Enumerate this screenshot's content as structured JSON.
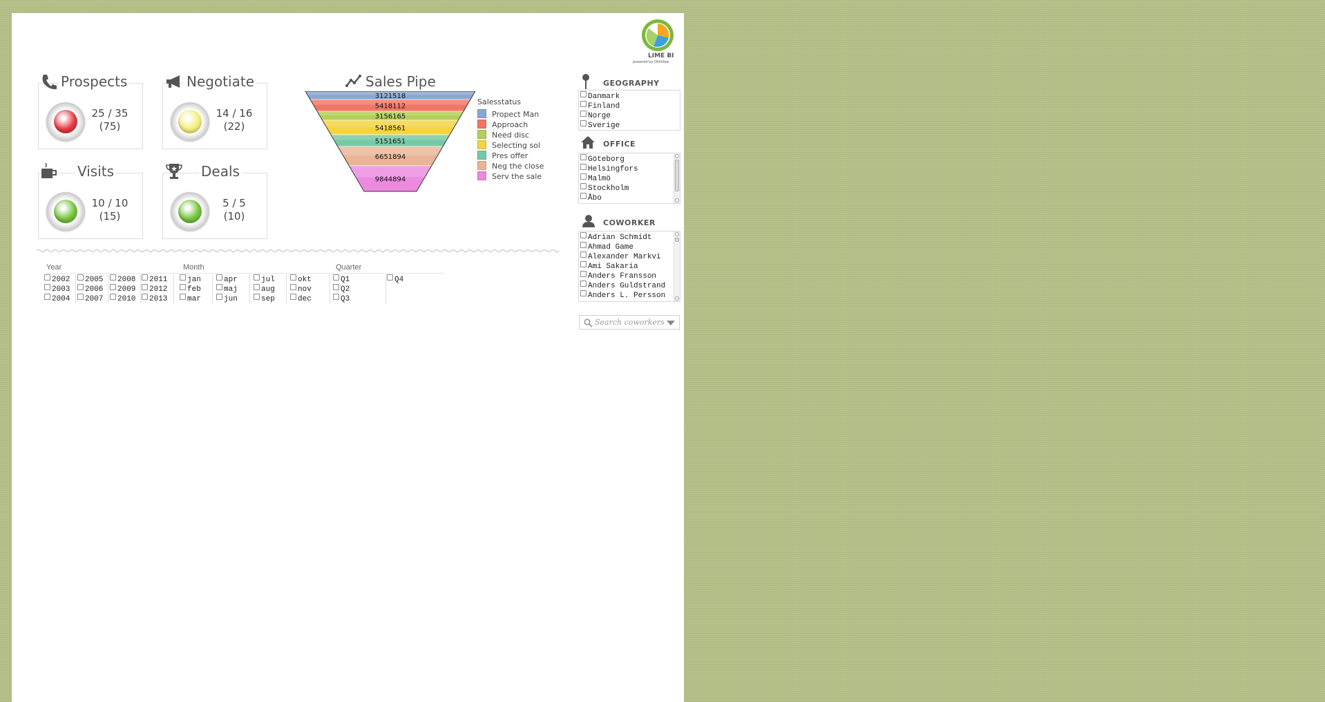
{
  "kpis": {
    "prospects": {
      "title": "Prospects",
      "value": "25 / 35",
      "sub": "(75)",
      "status": "red"
    },
    "negotiate": {
      "title": "Negotiate",
      "value": "14 / 16",
      "sub": "(22)",
      "status": "yellow"
    },
    "visits": {
      "title": "Visits",
      "value": "10 / 10",
      "sub": "(15)",
      "status": "green"
    },
    "deals": {
      "title": "Deals",
      "value": "5 / 5",
      "sub": "(10)",
      "status": "green"
    }
  },
  "status_colors": {
    "red": "#e8383f",
    "yellow": "#f4f07a",
    "green": "#74c43c"
  },
  "sales_pipe": {
    "title": "Sales Pipe",
    "legend_title": "Salesstatus"
  },
  "chart_data": {
    "type": "funnel",
    "title": "Sales Pipe",
    "legend_title": "Salesstatus",
    "series": [
      {
        "name": "Propect Man",
        "value": 3121518,
        "label": "3121518",
        "color": "#8aa7d0"
      },
      {
        "name": "Approach",
        "value": 5418112,
        "label": "5418112",
        "color": "#f27566"
      },
      {
        "name": "Need disc",
        "value": 3156165,
        "label": "3156165",
        "color": "#b4cf58"
      },
      {
        "name": "Selecting sol",
        "value": 5418561,
        "label": "5418561",
        "color": "#f5d440"
      },
      {
        "name": "Pres offer",
        "value": 5151651,
        "label": "5151651",
        "color": "#76c9a5"
      },
      {
        "name": "Neg the close",
        "value": 6651894,
        "label": "6651894",
        "color": "#e9b596"
      },
      {
        "name": "Serv the sale",
        "value": 9844894,
        "label": "9844894",
        "color": "#ec8ae0"
      }
    ]
  },
  "filters": {
    "year": {
      "label": "Year",
      "items": [
        "2002",
        "2003",
        "2004",
        "2005",
        "2006",
        "2007",
        "2008",
        "2009",
        "2010",
        "2011",
        "2012",
        "2013"
      ]
    },
    "month": {
      "label": "Month",
      "items": [
        "jan",
        "feb",
        "mar",
        "apr",
        "maj",
        "jun",
        "jul",
        "aug",
        "sep",
        "okt",
        "nov",
        "dec"
      ]
    },
    "quarter": {
      "label": "Quarter",
      "items": [
        "Q1",
        "Q2",
        "Q3",
        "Q4"
      ]
    }
  },
  "geography": {
    "title": "GEOGRAPHY",
    "items": [
      "Danmark",
      "Finland",
      "Norge",
      "Sverige"
    ]
  },
  "office": {
    "title": "OFFICE",
    "items": [
      "Göteborg",
      "Helsingfors",
      "Malmö",
      "Stockholm",
      "Åbo"
    ]
  },
  "coworker": {
    "title": "COWORKER",
    "items": [
      "Adrian Schmidt",
      "Ahmad Game",
      "Alexander Markvi",
      "Ami Sakaria",
      "Anders Fransson",
      "Anders Guldstrand",
      "Anders L. Persson"
    ],
    "search_placeholder": "Search coworkers"
  },
  "logo": {
    "name": "LIME BI",
    "tagline": "powered by QlikView"
  }
}
